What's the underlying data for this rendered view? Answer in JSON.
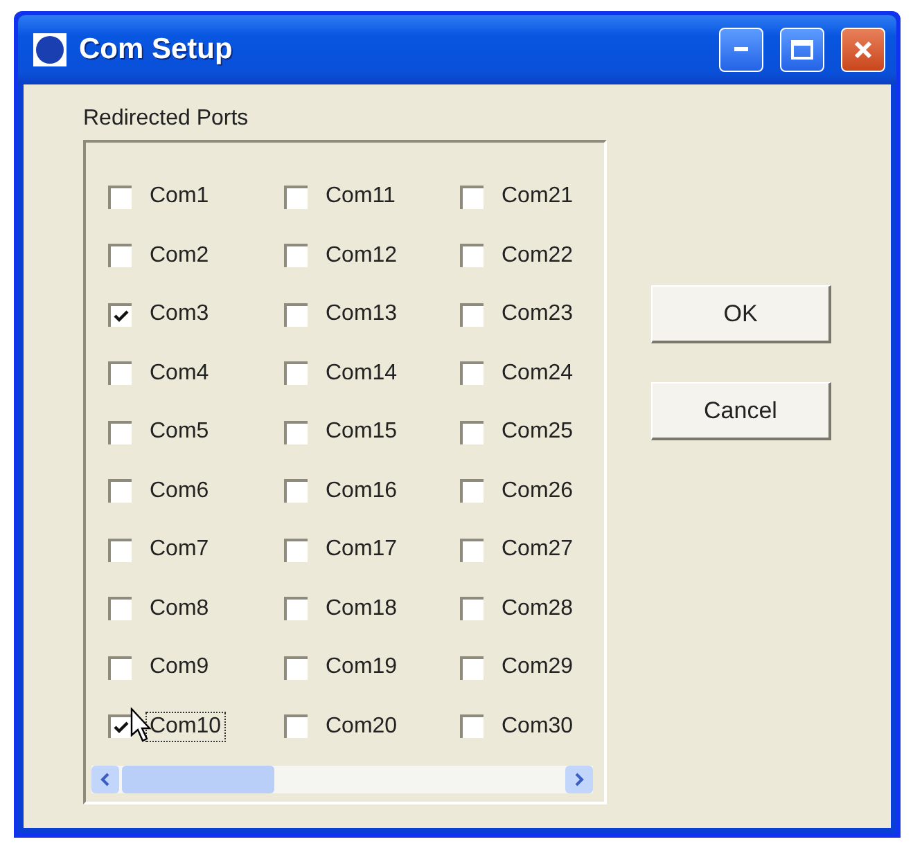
{
  "window": {
    "title": "Com Setup"
  },
  "group": {
    "label": "Redirected Ports"
  },
  "ports": [
    {
      "label": "Com1",
      "checked": false,
      "focused": false
    },
    {
      "label": "Com2",
      "checked": false,
      "focused": false
    },
    {
      "label": "Com3",
      "checked": true,
      "focused": false
    },
    {
      "label": "Com4",
      "checked": false,
      "focused": false
    },
    {
      "label": "Com5",
      "checked": false,
      "focused": false
    },
    {
      "label": "Com6",
      "checked": false,
      "focused": false
    },
    {
      "label": "Com7",
      "checked": false,
      "focused": false
    },
    {
      "label": "Com8",
      "checked": false,
      "focused": false
    },
    {
      "label": "Com9",
      "checked": false,
      "focused": false
    },
    {
      "label": "Com10",
      "checked": true,
      "focused": true
    },
    {
      "label": "Com11",
      "checked": false,
      "focused": false
    },
    {
      "label": "Com12",
      "checked": false,
      "focused": false
    },
    {
      "label": "Com13",
      "checked": false,
      "focused": false
    },
    {
      "label": "Com14",
      "checked": false,
      "focused": false
    },
    {
      "label": "Com15",
      "checked": false,
      "focused": false
    },
    {
      "label": "Com16",
      "checked": false,
      "focused": false
    },
    {
      "label": "Com17",
      "checked": false,
      "focused": false
    },
    {
      "label": "Com18",
      "checked": false,
      "focused": false
    },
    {
      "label": "Com19",
      "checked": false,
      "focused": false
    },
    {
      "label": "Com20",
      "checked": false,
      "focused": false
    },
    {
      "label": "Com21",
      "checked": false,
      "focused": false
    },
    {
      "label": "Com22",
      "checked": false,
      "focused": false
    },
    {
      "label": "Com23",
      "checked": false,
      "focused": false
    },
    {
      "label": "Com24",
      "checked": false,
      "focused": false
    },
    {
      "label": "Com25",
      "checked": false,
      "focused": false
    },
    {
      "label": "Com26",
      "checked": false,
      "focused": false
    },
    {
      "label": "Com27",
      "checked": false,
      "focused": false
    },
    {
      "label": "Com28",
      "checked": false,
      "focused": false
    },
    {
      "label": "Com29",
      "checked": false,
      "focused": false
    },
    {
      "label": "Com30",
      "checked": false,
      "focused": false
    }
  ],
  "buttons": [
    "OK",
    "Cancel"
  ]
}
